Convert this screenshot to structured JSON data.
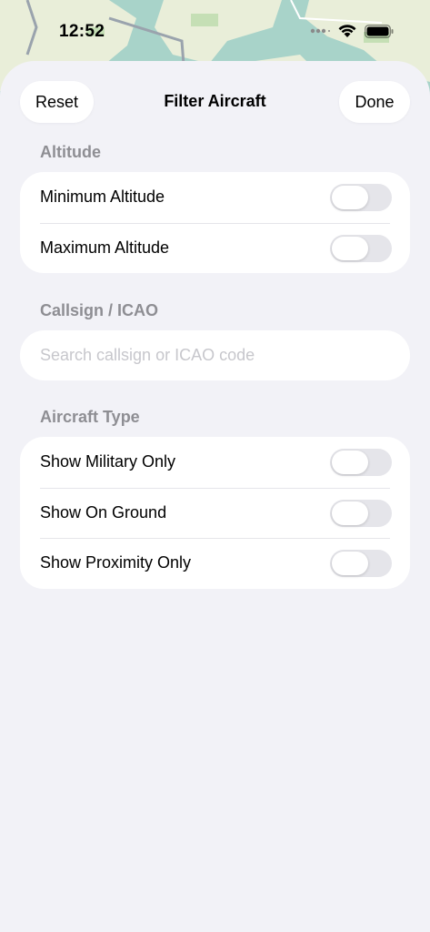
{
  "status_bar": {
    "time": "12:52",
    "icons": [
      "signal-dots-icon",
      "wifi-icon",
      "battery-icon"
    ]
  },
  "nav": {
    "reset_label": "Reset",
    "title": "Filter Aircraft",
    "done_label": "Done"
  },
  "altitude": {
    "header": "Altitude",
    "rows": [
      {
        "label": "Minimum Altitude",
        "enabled": false
      },
      {
        "label": "Maximum Altitude",
        "enabled": false
      }
    ]
  },
  "callsign": {
    "header": "Callsign / ICAO",
    "value": "",
    "placeholder": "Search callsign or ICAO code"
  },
  "aircraft_type": {
    "header": "Aircraft Type",
    "rows": [
      {
        "label": "Show Military Only",
        "enabled": false
      },
      {
        "label": "Show On Ground",
        "enabled": false
      },
      {
        "label": "Show Proximity Only",
        "enabled": false
      }
    ]
  },
  "colors": {
    "background": "#f2f2f7",
    "card": "#ffffff",
    "section_header": "#8e8e93",
    "toggle_off": "#e5e5ea",
    "placeholder": "#c7c7cc",
    "map_water": "#a8d3c9",
    "map_land": "#e9eed9"
  }
}
